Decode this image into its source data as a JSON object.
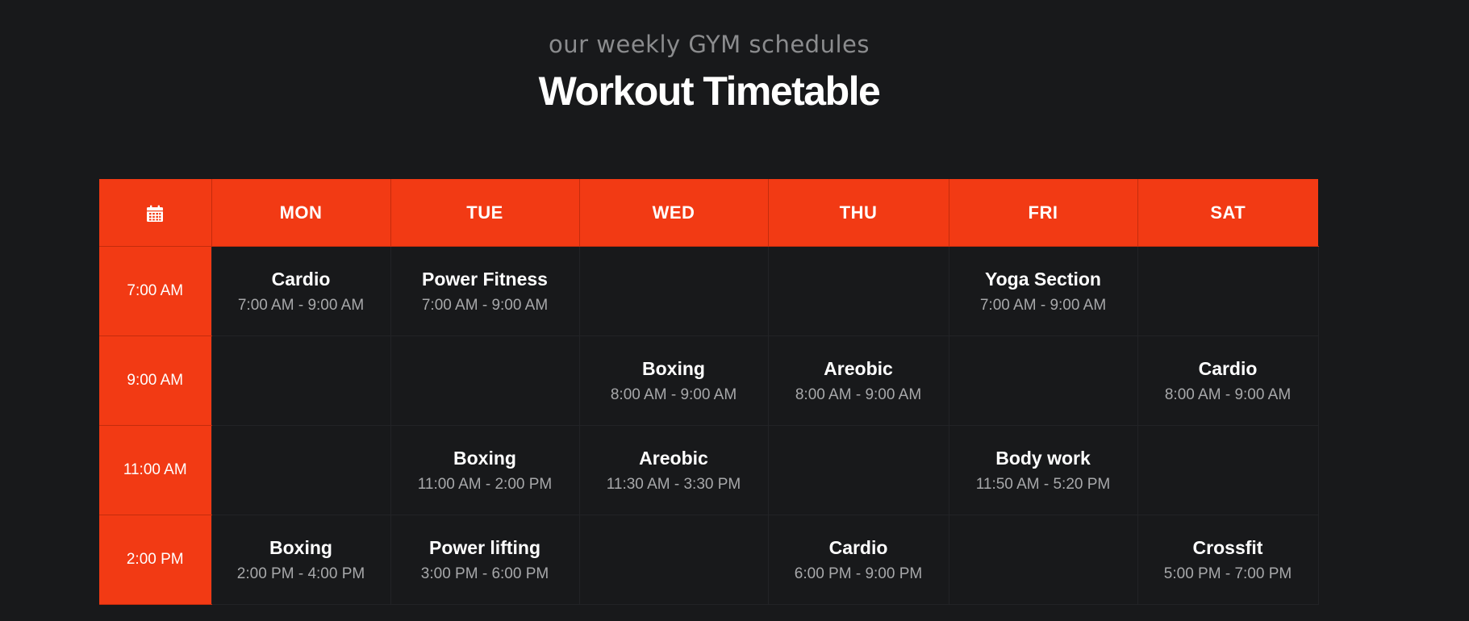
{
  "header": {
    "subtitle": "our weekly GYM schedules",
    "title": "Workout Timetable"
  },
  "icon": "calendar-icon",
  "colors": {
    "accent": "#f23a14",
    "background": "#18191b",
    "muted_text": "#a7a8aa"
  },
  "days": [
    "MON",
    "TUE",
    "WED",
    "THU",
    "FRI",
    "SAT"
  ],
  "rows": [
    {
      "time": "7:00 AM",
      "cells": [
        {
          "name": "Cardio",
          "time": "7:00 AM - 9:00 AM"
        },
        {
          "name": "Power Fitness",
          "time": "7:00 AM - 9:00 AM"
        },
        {
          "name": "",
          "time": ""
        },
        {
          "name": "",
          "time": ""
        },
        {
          "name": "Yoga Section",
          "time": "7:00 AM - 9:00 AM"
        },
        {
          "name": "",
          "time": ""
        }
      ]
    },
    {
      "time": "9:00 AM",
      "cells": [
        {
          "name": "",
          "time": ""
        },
        {
          "name": "",
          "time": ""
        },
        {
          "name": "Boxing",
          "time": "8:00 AM - 9:00 AM"
        },
        {
          "name": "Areobic",
          "time": "8:00 AM - 9:00 AM"
        },
        {
          "name": "",
          "time": ""
        },
        {
          "name": "Cardio",
          "time": "8:00 AM - 9:00 AM"
        }
      ]
    },
    {
      "time": "11:00 AM",
      "cells": [
        {
          "name": "",
          "time": ""
        },
        {
          "name": "Boxing",
          "time": "11:00 AM - 2:00 PM"
        },
        {
          "name": "Areobic",
          "time": "11:30 AM - 3:30 PM"
        },
        {
          "name": "",
          "time": ""
        },
        {
          "name": "Body work",
          "time": "11:50 AM - 5:20 PM"
        },
        {
          "name": "",
          "time": ""
        }
      ]
    },
    {
      "time": "2:00 PM",
      "cells": [
        {
          "name": "Boxing",
          "time": "2:00 PM - 4:00 PM"
        },
        {
          "name": "Power lifting",
          "time": "3:00 PM - 6:00 PM"
        },
        {
          "name": "",
          "time": ""
        },
        {
          "name": "Cardio",
          "time": "6:00 PM - 9:00 PM"
        },
        {
          "name": "",
          "time": ""
        },
        {
          "name": "Crossfit",
          "time": "5:00 PM - 7:00 PM"
        }
      ]
    }
  ]
}
